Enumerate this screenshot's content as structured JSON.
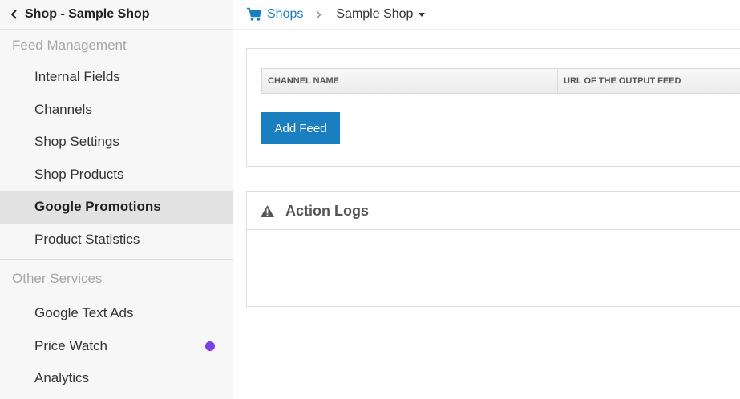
{
  "sidebar": {
    "title": "Shop - Sample Shop",
    "sections": [
      {
        "label": "Feed Management",
        "items": [
          {
            "label": "Internal Fields"
          },
          {
            "label": "Channels"
          },
          {
            "label": "Shop Settings"
          },
          {
            "label": "Shop Products"
          },
          {
            "label": "Google Promotions",
            "active": true
          },
          {
            "label": "Product Statistics"
          }
        ]
      },
      {
        "label": "Other Services",
        "items": [
          {
            "label": "Google Text Ads"
          },
          {
            "label": "Price Watch",
            "badge_color": "#7b3fe4"
          },
          {
            "label": "Analytics"
          }
        ]
      }
    ]
  },
  "breadcrumb": {
    "root": "Shops",
    "current": "Sample Shop"
  },
  "feed_panel": {
    "columns": [
      "CHANNEL NAME",
      "URL OF THE OUTPUT FEED"
    ],
    "add_button": "Add Feed"
  },
  "logs_panel": {
    "title": "Action Logs"
  },
  "colors": {
    "accent": "#1a7fc1",
    "badge": "#7b3fe4"
  }
}
